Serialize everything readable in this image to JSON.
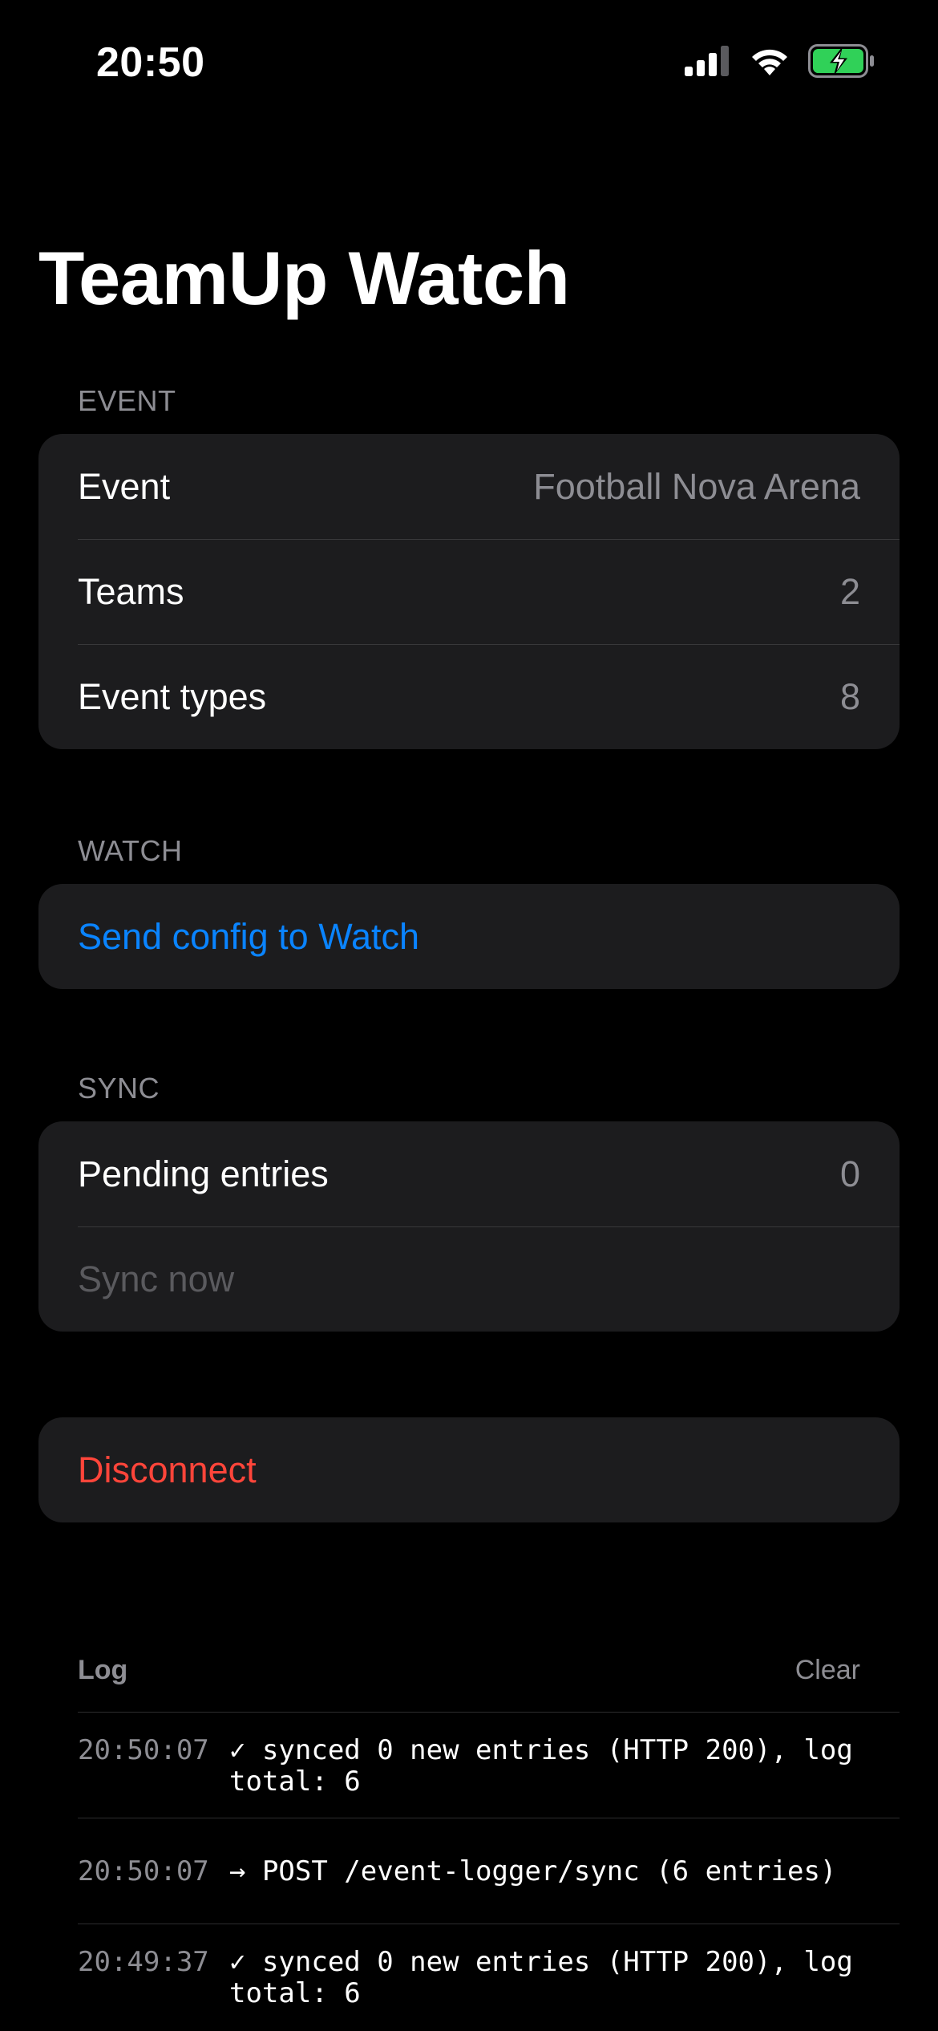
{
  "status_bar": {
    "time": "20:50",
    "signal_icon": "cellular-signal-icon",
    "wifi_icon": "wifi-icon",
    "battery_icon": "battery-charging-icon"
  },
  "title": "TeamUp Watch",
  "sections": {
    "event": {
      "header": "EVENT",
      "rows": [
        {
          "label": "Event",
          "value": "Football Nova Arena"
        },
        {
          "label": "Teams",
          "value": "2"
        },
        {
          "label": "Event types",
          "value": "8"
        }
      ]
    },
    "watch": {
      "header": "WATCH",
      "send_config_label": "Send config to Watch"
    },
    "sync": {
      "header": "SYNC",
      "pending_label": "Pending entries",
      "pending_value": "0",
      "sync_now_label": "Sync now"
    },
    "disconnect_label": "Disconnect"
  },
  "log": {
    "title": "Log",
    "clear_label": "Clear",
    "entries": [
      {
        "time": "20:50:07",
        "message": "✓ synced 0 new entries (HTTP 200), log\ntotal: 6"
      },
      {
        "time": "20:50:07",
        "message": "→ POST /event-logger/sync (6 entries)"
      },
      {
        "time": "20:49:37",
        "message": "✓ synced 0 new entries (HTTP 200), log\ntotal: 6"
      }
    ]
  },
  "colors": {
    "background": "#000000",
    "card": "#1c1c1e",
    "accent_blue": "#0a84ff",
    "destructive_red": "#ff453a",
    "secondary_text": "#8d8d93",
    "battery_green": "#30d158"
  }
}
